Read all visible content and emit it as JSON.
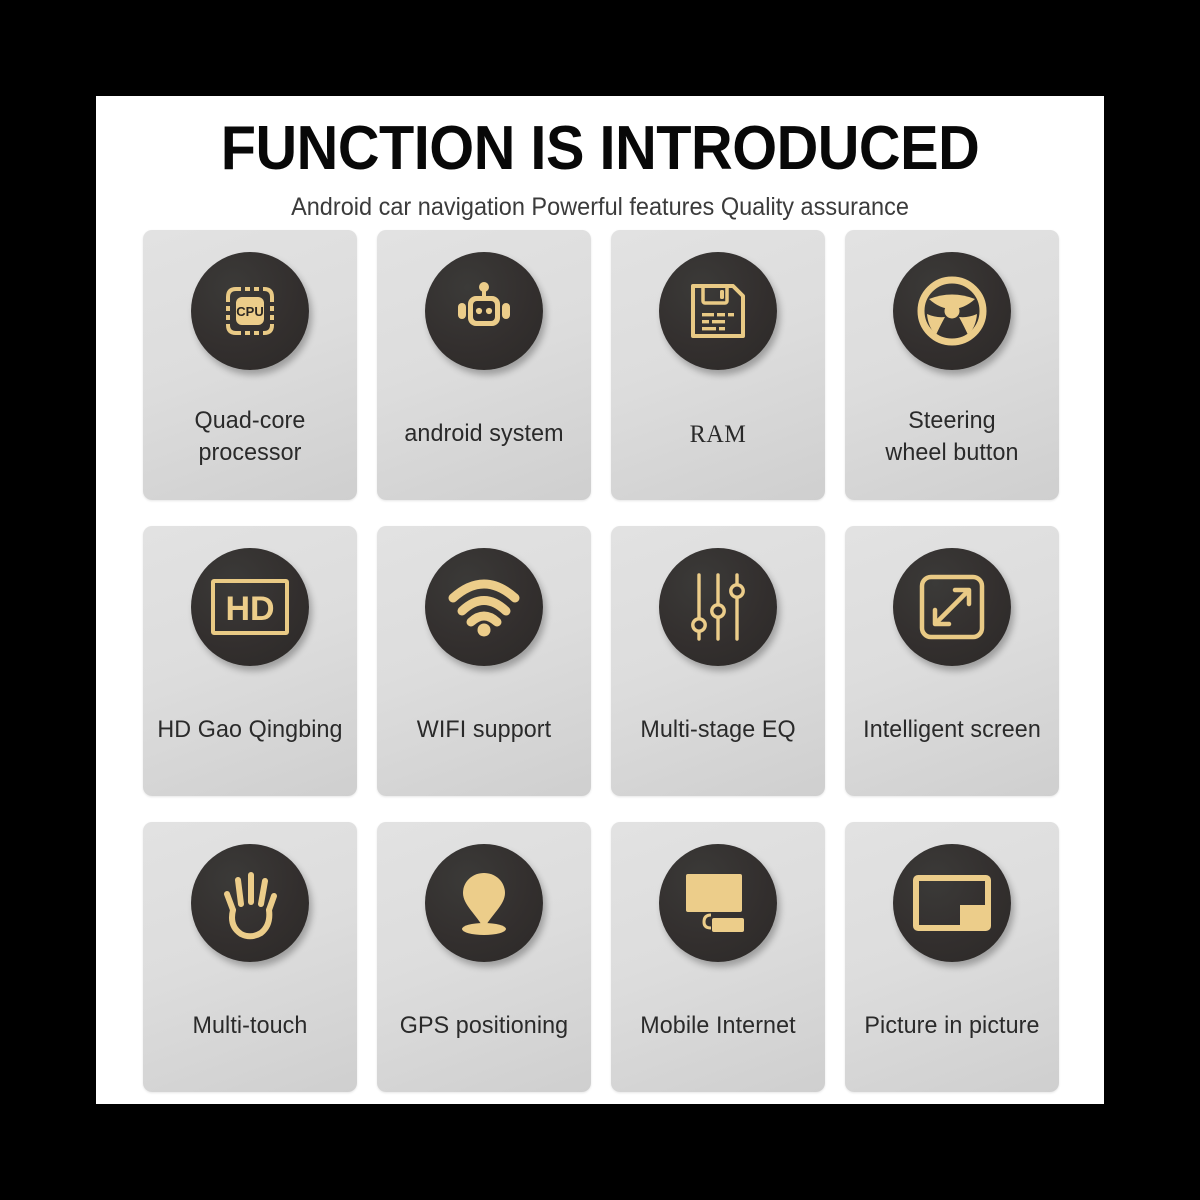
{
  "page": {
    "background_color": "#000000",
    "panel_color": "#ffffff",
    "accent_gold": "#e9ca85",
    "badge_dark": "#332f2e",
    "card_gray": "#dddddd"
  },
  "header": {
    "title": "FUNCTION IS INTRODUCED",
    "subtitle": "Android car navigation Powerful features Quality assurance"
  },
  "grid": {
    "columns": 4,
    "rows": 3,
    "cards": [
      {
        "label": "Quad-core\nprocessor",
        "icon": "cpu-chip-icon",
        "icon_text": "CPU",
        "style": "sans"
      },
      {
        "label": "android system",
        "icon": "android-robot-icon",
        "style": "sans"
      },
      {
        "label": "RAM",
        "icon": "memory-floppy-icon",
        "style": "serif"
      },
      {
        "label": "Steering\nwheel button",
        "icon": "steering-wheel-icon",
        "style": "sans"
      },
      {
        "label": "HD Gao Qingbing",
        "icon": "hd-screen-icon",
        "icon_text": "HD",
        "style": "sans"
      },
      {
        "label": "WIFI support",
        "icon": "wifi-icon",
        "style": "sans"
      },
      {
        "label": "Multi-stage EQ",
        "icon": "equalizer-sliders-icon",
        "style": "sans"
      },
      {
        "label": "Intelligent screen",
        "icon": "expand-screen-icon",
        "style": "sans"
      },
      {
        "label": "Multi-touch",
        "icon": "hand-touch-icon",
        "style": "sans"
      },
      {
        "label": "GPS positioning",
        "icon": "map-pin-icon",
        "style": "sans"
      },
      {
        "label": "Mobile Internet",
        "icon": "monitor-icon",
        "style": "sans"
      },
      {
        "label": "Picture in picture",
        "icon": "picture-in-picture-icon",
        "style": "sans"
      }
    ]
  }
}
